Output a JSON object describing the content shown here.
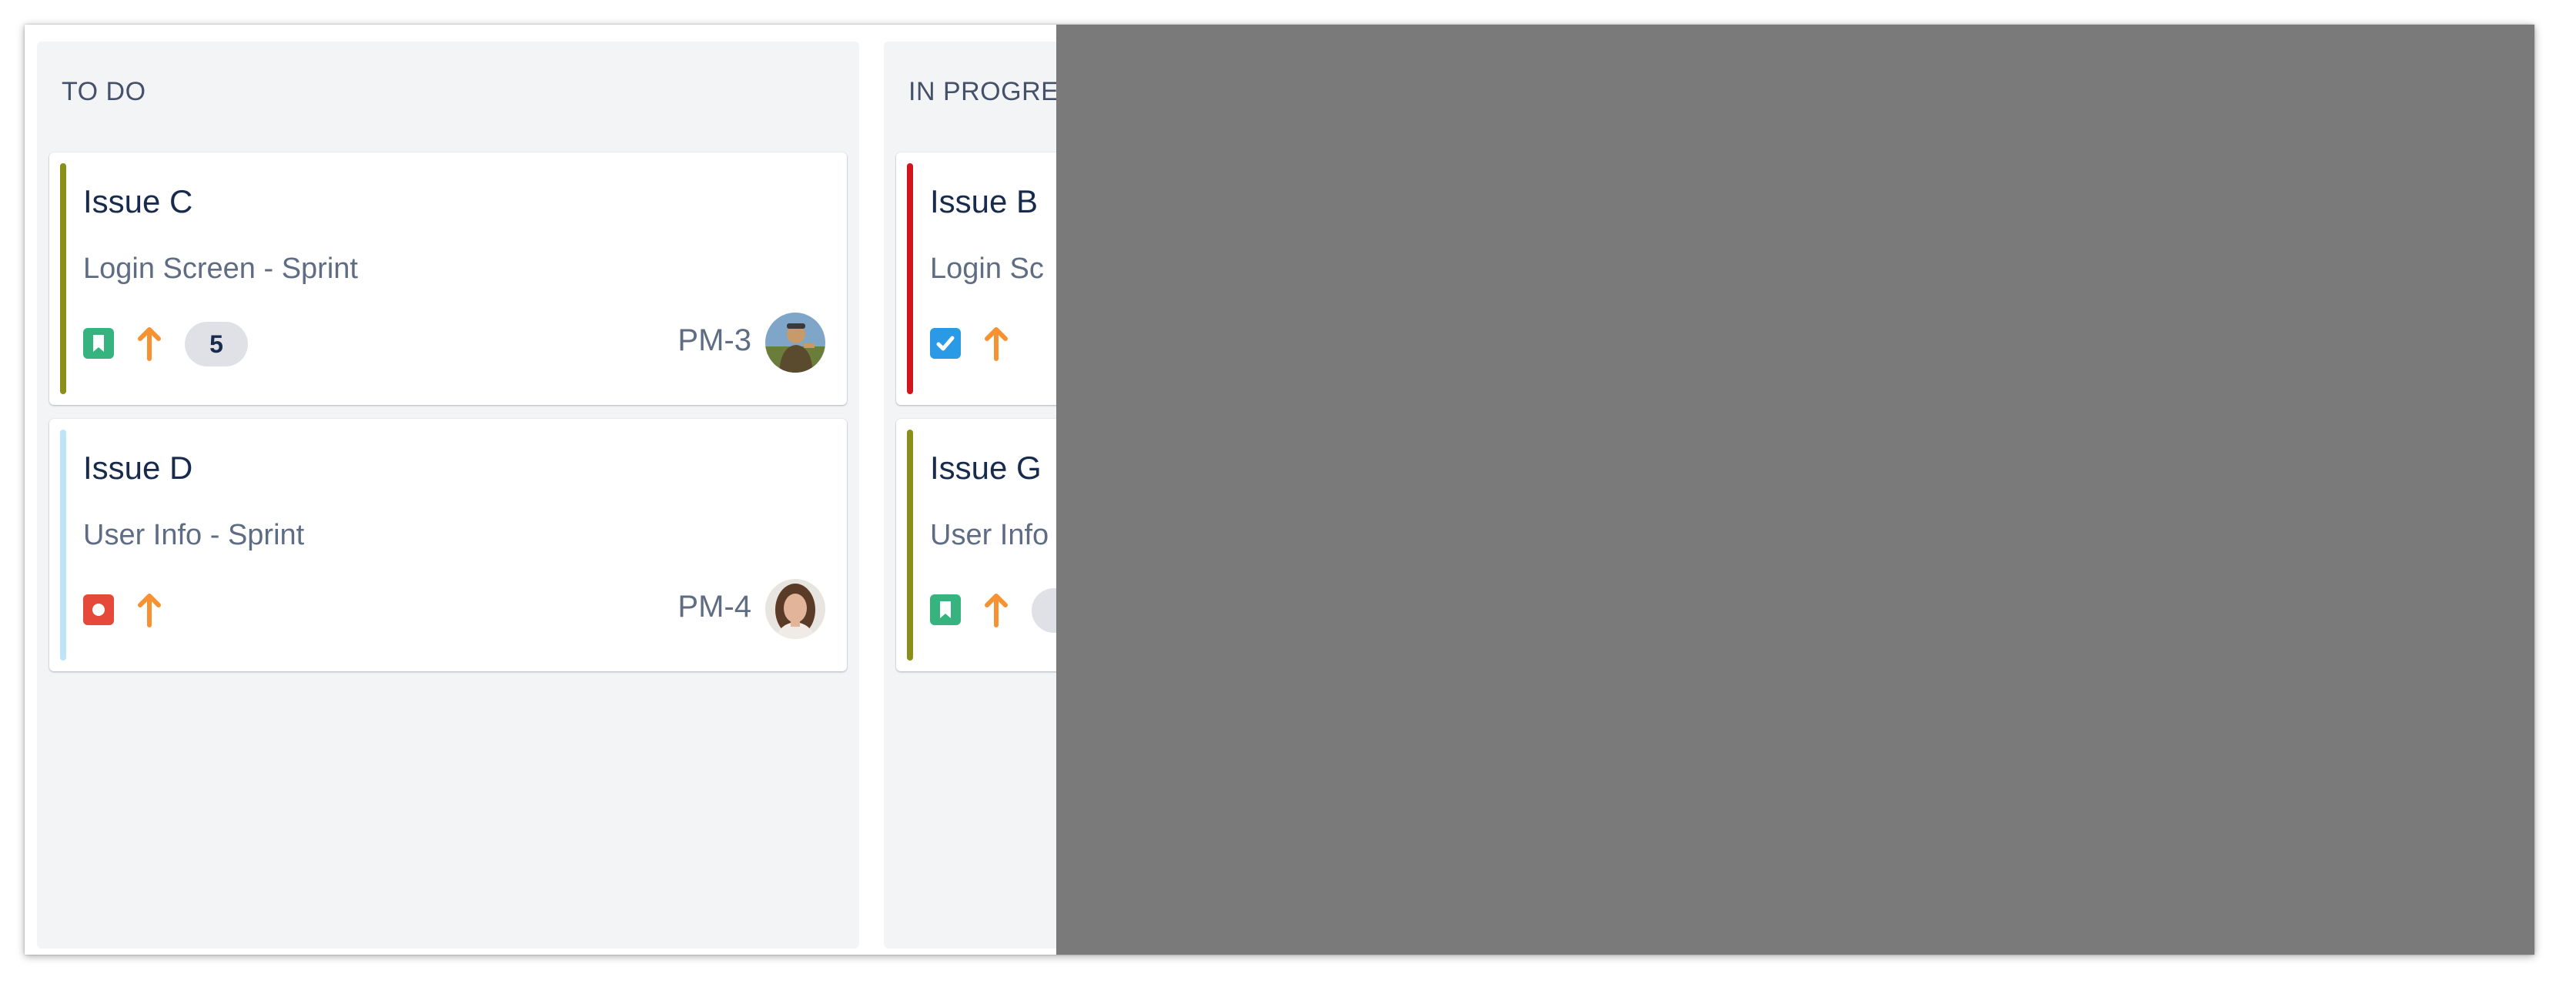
{
  "colors": {
    "overlay": "#7a7a7a",
    "column_bg": "#f3f4f6",
    "story_type": "#36b37e",
    "bug_type": "#e5493a",
    "task_type": "#2b9ae6",
    "priority_high": "#f79232"
  },
  "columns": [
    {
      "title": "TO DO",
      "cards": [
        {
          "title": "Issue C",
          "epic": "Login Screen - Sprint",
          "epic_color": "#8a8f1a",
          "type_icon": "story-icon",
          "priority_icon": "priority-high-icon",
          "estimate": "5",
          "key": "PM-3",
          "avatar": "avatar-man-icon"
        },
        {
          "title": "Issue D",
          "epic": "User Info - Sprint",
          "epic_color": "#bfe3f7",
          "type_icon": "bug-icon",
          "priority_icon": "priority-high-icon",
          "key": "PM-4",
          "avatar": "avatar-woman-icon"
        }
      ]
    },
    {
      "title": "IN PROGRE",
      "cards": [
        {
          "title": "Issue B",
          "epic": "Login Sc",
          "epic_color": "#d0161c",
          "type_icon": "task-icon",
          "priority_icon": "priority-high-icon"
        },
        {
          "title": "Issue G",
          "epic": "User Info",
          "epic_color": "#8a8f1a",
          "type_icon": "story-icon",
          "priority_icon": "priority-high-icon"
        }
      ]
    }
  ]
}
